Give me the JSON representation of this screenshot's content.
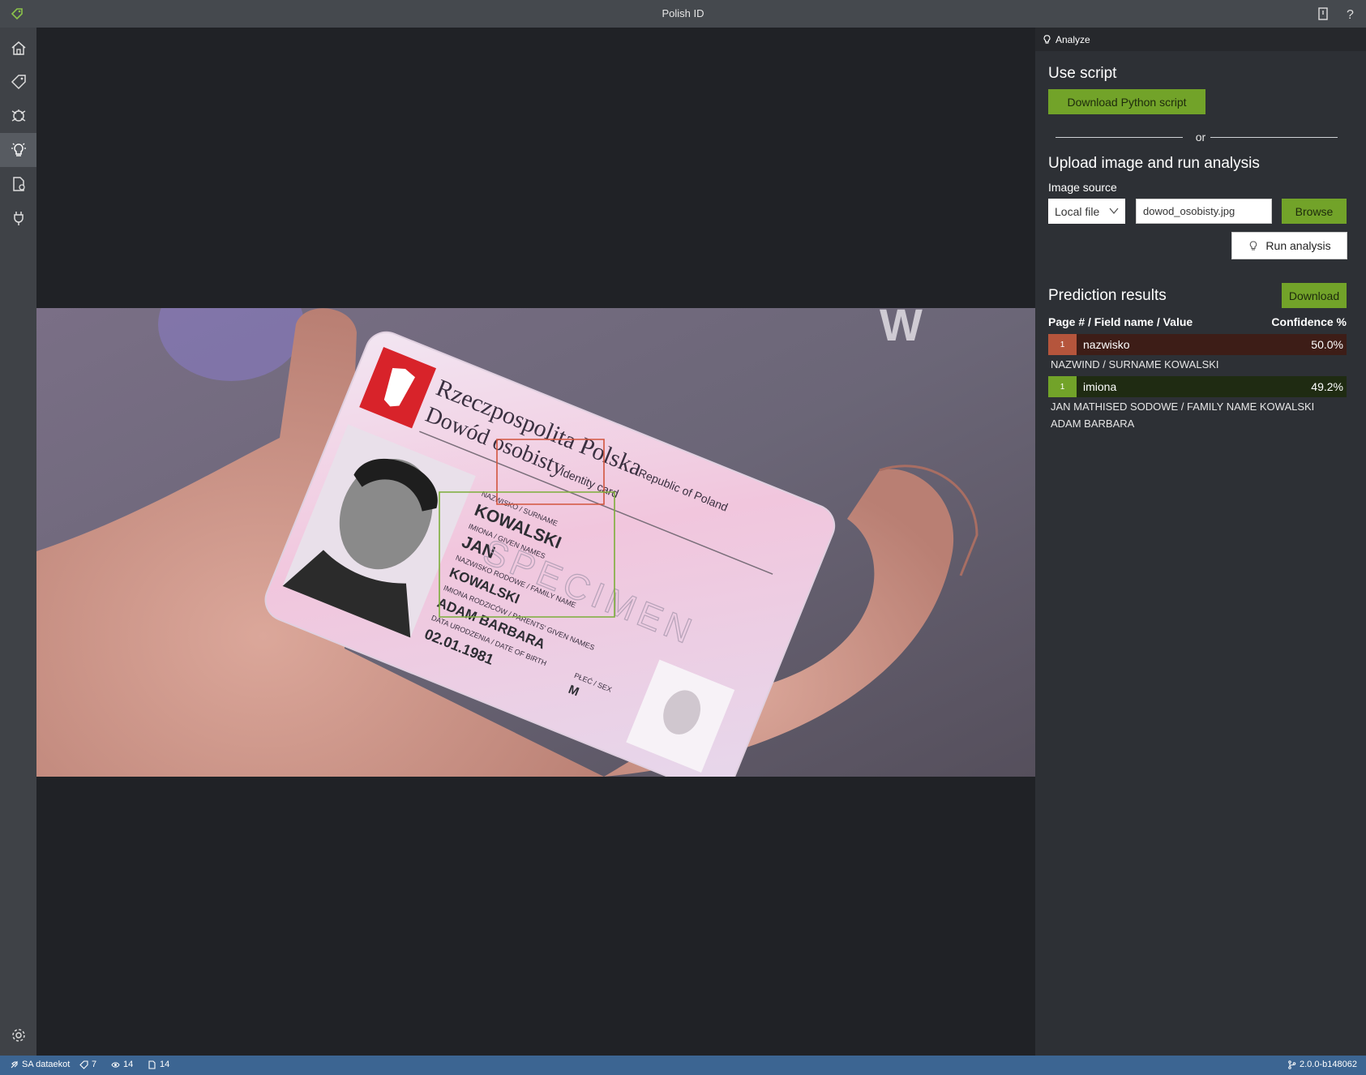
{
  "window": {
    "title": "Polish ID"
  },
  "sidebar": {
    "items": [
      {
        "icon": "home-icon"
      },
      {
        "icon": "tag-icon"
      },
      {
        "icon": "train-icon"
      },
      {
        "icon": "analyze-lightbulb-icon"
      },
      {
        "icon": "project-settings-icon"
      },
      {
        "icon": "connections-plug-icon"
      }
    ],
    "bottom_icon": "settings-gear-icon"
  },
  "canvas": {
    "card_text": {
      "country": "Rzeczpospolita Polska",
      "country_en": "Republic of Poland",
      "doc": "Dowód osobisty",
      "doc_en": "Identity card",
      "surname_label": "NAZWISKO / SURNAME",
      "surname": "KOWALSKI",
      "given_label": "IMIONA / GIVEN NAMES",
      "given": "JAN",
      "family_label": "NAZWISKO RODOWE / FAMILY NAME",
      "family": "KOWALSKI",
      "parents_label": "IMIONA RODZICÓW / PARENTS' GIVEN NAMES",
      "parents": "ADAM BARBARA",
      "dob_label": "DATA URODZENIA / DATE OF BIRTH",
      "dob": "02.01.1981",
      "sex_label": "PŁEĆ / SEX",
      "sex": "M",
      "specimen": "SPECIMEN"
    }
  },
  "panel": {
    "header": "Analyze",
    "use_script_heading": "Use script",
    "download_script_label": "Download Python script",
    "or_text": "or",
    "upload_heading": "Upload image and run analysis",
    "image_source_label": "Image source",
    "source_select_value": "Local file",
    "file_input_value": "dowod_osobisty.jpg",
    "browse_label": "Browse",
    "run_analysis_label": "Run analysis",
    "results_heading": "Prediction results",
    "download_label": "Download",
    "results_col_left": "Page # / Field name / Value",
    "results_col_right": "Confidence %",
    "results": [
      {
        "page": "1",
        "field": "nazwisko",
        "confidence": "50.0%",
        "value": "NAZWIND / SURNAME KOWALSKI",
        "color": "#b5553c",
        "row_bg": "#3d1d17"
      },
      {
        "page": "1",
        "field": "imiona",
        "confidence": "49.2%",
        "value": "JAN MATHISED SODOWE / FAMILY NAME KOWALSKI ADAM BARBARA",
        "color": "#72a329",
        "row_bg": "#1f2b12"
      }
    ]
  },
  "statusbar": {
    "project": "SA dataekot",
    "tags": "7",
    "visited": "14",
    "assets": "14",
    "version": "2.0.0-b148062"
  }
}
